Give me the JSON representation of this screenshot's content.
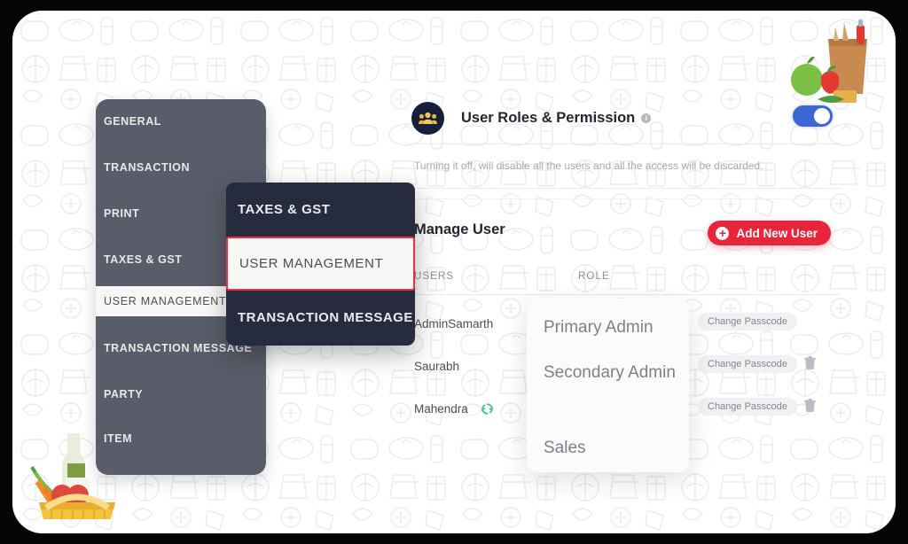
{
  "sidebar": {
    "items": [
      {
        "label": "GENERAL",
        "active": false
      },
      {
        "label": "TRANSACTION",
        "active": false
      },
      {
        "label": "PRINT",
        "active": false
      },
      {
        "label": "TAXES & GST",
        "active": false
      },
      {
        "label": "USER MANAGEMENT",
        "active": true
      },
      {
        "label": "TRANSACTION MESSAGE",
        "active": false
      },
      {
        "label": "PARTY",
        "active": false
      },
      {
        "label": "ITEM",
        "active": false
      }
    ]
  },
  "callout": {
    "items": [
      {
        "label": "TAXES & GST",
        "highlighted": false
      },
      {
        "label": "USER MANAGEMENT",
        "highlighted": true
      },
      {
        "label": "TRANSACTION MESSAGE",
        "highlighted": false
      }
    ],
    "highlight_color": "#e8323c"
  },
  "panel": {
    "title": "User Roles & Permission",
    "info_glyph": "i",
    "toggle_state": "on",
    "toggle_color": "#3b66d4",
    "description": "Turning it off, will disable all the users and all the access will be discarded.",
    "manage_title": "Manage User",
    "add_user_label": "Add New User",
    "add_user_color": "#e8253a",
    "add_user_glyph": "+",
    "columns": [
      "USERS",
      "ROLE"
    ],
    "rows": [
      {
        "user": "AdminSamarth",
        "role": "Primary Admin",
        "passcode_label": "Change Passcode",
        "has_delete": false,
        "has_sync": false
      },
      {
        "user": "Saurabh",
        "role": "Secondary Admin",
        "passcode_label": "Change Passcode",
        "has_delete": true,
        "has_sync": false
      },
      {
        "user": "Mahendra",
        "role": "Sales",
        "passcode_label": "Change Passcode",
        "has_delete": true,
        "has_sync": true,
        "sync_color": "#3dbf8e"
      }
    ]
  },
  "role_dropdown": {
    "options": [
      "Primary Admin",
      "Secondary Admin",
      "Sales"
    ]
  }
}
